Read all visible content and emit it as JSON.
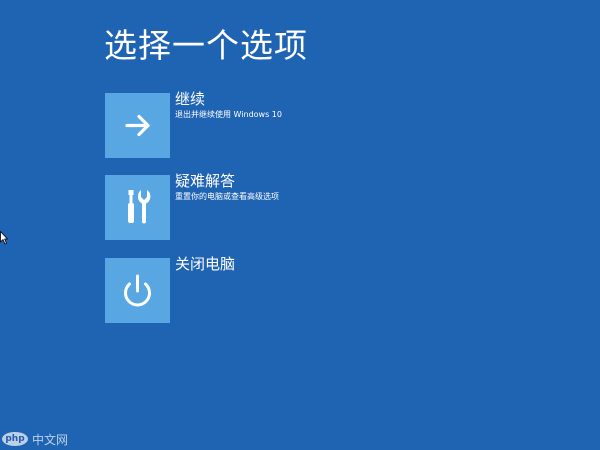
{
  "page": {
    "title": "选择一个选项"
  },
  "options": [
    {
      "title": "继续",
      "description": "退出并继续使用 Windows 10",
      "icon": "arrow-right-icon"
    },
    {
      "title": "疑难解答",
      "description": "重置你的电脑或查看高级选项",
      "icon": "tools-icon"
    },
    {
      "title": "关闭电脑",
      "description": "",
      "icon": "power-icon"
    }
  ],
  "watermark": {
    "logo_text": "php",
    "text": "中文网"
  },
  "colors": {
    "background": "#1f63b3",
    "tile": "#58a7e3",
    "text": "#ffffff"
  }
}
